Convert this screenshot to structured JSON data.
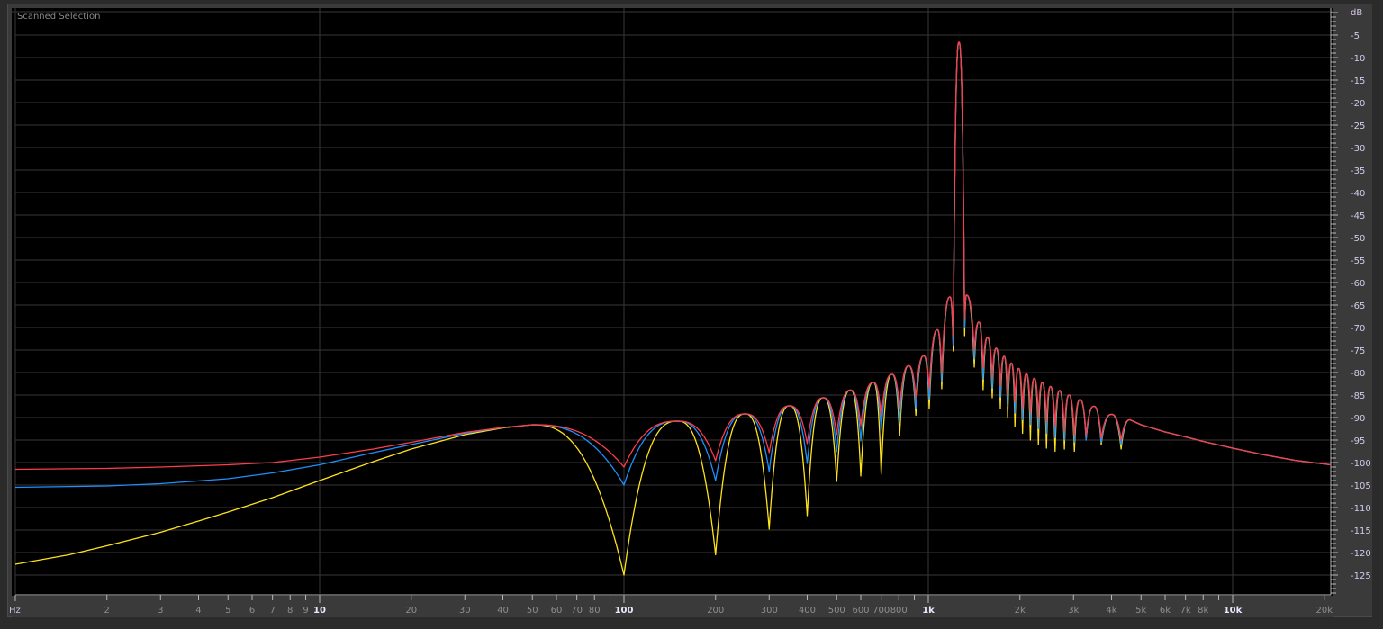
{
  "panel_title": "Scanned Selection",
  "chart_data": {
    "type": "line",
    "title": "",
    "xlabel": "Hz",
    "ylabel": "dB",
    "x_scale": "log",
    "xlim": [
      1,
      21000
    ],
    "ylim": [
      -129,
      0
    ],
    "grid": true,
    "background": "#000000",
    "grid_color": "#3b3638",
    "x_ticks": [
      {
        "hz": 2,
        "label": "2"
      },
      {
        "hz": 3,
        "label": "3"
      },
      {
        "hz": 4,
        "label": "4"
      },
      {
        "hz": 5,
        "label": "5"
      },
      {
        "hz": 6,
        "label": "6"
      },
      {
        "hz": 7,
        "label": "7"
      },
      {
        "hz": 8,
        "label": "8"
      },
      {
        "hz": 9,
        "label": "9"
      },
      {
        "hz": 10,
        "label": "10",
        "major": true
      },
      {
        "hz": 20,
        "label": "20"
      },
      {
        "hz": 30,
        "label": "30"
      },
      {
        "hz": 40,
        "label": "40"
      },
      {
        "hz": 50,
        "label": "50"
      },
      {
        "hz": 60,
        "label": "60"
      },
      {
        "hz": 70,
        "label": "70"
      },
      {
        "hz": 80,
        "label": "80"
      },
      {
        "hz": 90,
        "label": ""
      },
      {
        "hz": 100,
        "label": "100",
        "major": true
      },
      {
        "hz": 200,
        "label": "200"
      },
      {
        "hz": 300,
        "label": "300"
      },
      {
        "hz": 400,
        "label": "400"
      },
      {
        "hz": 500,
        "label": "500"
      },
      {
        "hz": 600,
        "label": "600"
      },
      {
        "hz": 700,
        "label": "700"
      },
      {
        "hz": 800,
        "label": "800"
      },
      {
        "hz": 900,
        "label": ""
      },
      {
        "hz": 1000,
        "label": "1k",
        "major": true
      },
      {
        "hz": 2000,
        "label": "2k"
      },
      {
        "hz": 3000,
        "label": "3k"
      },
      {
        "hz": 4000,
        "label": "4k"
      },
      {
        "hz": 5000,
        "label": "5k"
      },
      {
        "hz": 6000,
        "label": "6k"
      },
      {
        "hz": 7000,
        "label": "7k"
      },
      {
        "hz": 8000,
        "label": "8k"
      },
      {
        "hz": 9000,
        "label": ""
      },
      {
        "hz": 10000,
        "label": "10k",
        "major": true
      },
      {
        "hz": 20000,
        "label": "20k"
      }
    ],
    "y_ticks": [
      -5,
      -10,
      -15,
      -20,
      -25,
      -30,
      -35,
      -40,
      -45,
      -50,
      -55,
      -60,
      -65,
      -70,
      -75,
      -80,
      -85,
      -90,
      -95,
      -100,
      -105,
      -110,
      -115,
      -120,
      -125
    ],
    "y_tick_labels": [
      "-5",
      "-10",
      "-15",
      "-20",
      "-25",
      "-30",
      "-35",
      "-40",
      "-45",
      "-50",
      "-55",
      "-60",
      "-65",
      "-70",
      "-75",
      "-80",
      "-85",
      "-90",
      "-95",
      "-100",
      "-105",
      "-110",
      "-115",
      "-120",
      "-125"
    ],
    "lobe_peaks": [
      [
        150,
        -90.8
      ],
      [
        250,
        -89.2
      ],
      [
        350,
        -87.4
      ],
      [
        452,
        -85.6
      ],
      [
        555,
        -83.9
      ],
      [
        660,
        -82.2
      ],
      [
        760,
        -80.4
      ],
      [
        862,
        -78.5
      ],
      [
        966,
        -76.3
      ],
      [
        1071,
        -70.5
      ],
      [
        1178,
        -63.2
      ],
      [
        1261,
        -6.6
      ],
      [
        1335,
        -62.8
      ],
      [
        1466,
        -68.8
      ],
      [
        1565,
        -72.2
      ],
      [
        1672,
        -74.6
      ],
      [
        1775,
        -76.4
      ],
      [
        1875,
        -77.9
      ],
      [
        1980,
        -79.1
      ],
      [
        2100,
        -80.3
      ],
      [
        2230,
        -81.3
      ],
      [
        2370,
        -82.2
      ],
      [
        2520,
        -83.1
      ],
      [
        2700,
        -84
      ],
      [
        2900,
        -85
      ],
      [
        3150,
        -86
      ],
      [
        3500,
        -87.5
      ],
      [
        4000,
        -89.3
      ],
      [
        4600,
        -90.5
      ],
      [
        5000,
        -91.6
      ],
      [
        6000,
        -93.2
      ],
      [
        7000,
        -94.3
      ],
      [
        8000,
        -95.3
      ],
      [
        10000,
        -96.8
      ],
      [
        12500,
        -98.2
      ],
      [
        16000,
        -99.5
      ],
      [
        21000,
        -100.5
      ]
    ],
    "series": [
      {
        "color": "#ffe31a",
        "points": [
          [
            1,
            -122.6
          ],
          [
            1.5,
            -120.5
          ],
          [
            2,
            -118.5
          ],
          [
            3,
            -115.5
          ],
          [
            4,
            -113
          ],
          [
            5,
            -111
          ],
          [
            7,
            -107.8
          ],
          [
            10,
            -104
          ],
          [
            15,
            -99.8
          ],
          [
            20,
            -97
          ],
          [
            30,
            -93.8
          ],
          [
            40,
            -92.3
          ],
          [
            50,
            -91.6
          ],
          [
            100,
            -125
          ],
          [
            200,
            -120.5
          ],
          [
            300,
            -114.8
          ],
          [
            400,
            -111.8
          ],
          [
            500,
            -104.2
          ],
          [
            600,
            -103
          ],
          [
            700,
            -102.6
          ],
          [
            805,
            -94
          ],
          [
            910,
            -89.5
          ],
          [
            1007,
            -88
          ],
          [
            1107,
            -83.6
          ],
          [
            1208,
            -75.2
          ],
          [
            1316,
            -71.8
          ],
          [
            1416,
            -78.8
          ],
          [
            1514,
            -83.8
          ],
          [
            1622,
            -85.6
          ],
          [
            1725,
            -88
          ],
          [
            1823,
            -90
          ],
          [
            1926,
            -92
          ],
          [
            2040,
            -93.5
          ],
          [
            2165,
            -95
          ],
          [
            2300,
            -96
          ],
          [
            2445,
            -96.8
          ],
          [
            2610,
            -97.5
          ],
          [
            2800,
            -97
          ],
          [
            3020,
            -97.5
          ],
          [
            3300,
            -95
          ],
          [
            3700,
            -96
          ],
          [
            4300,
            -97
          ]
        ]
      },
      {
        "color": "#1e8fff",
        "points": [
          [
            1,
            -105.5
          ],
          [
            2,
            -105.2
          ],
          [
            3,
            -104.7
          ],
          [
            5,
            -103.6
          ],
          [
            7,
            -102.3
          ],
          [
            10,
            -100.5
          ],
          [
            15,
            -97.8
          ],
          [
            20,
            -96
          ],
          [
            30,
            -93.5
          ],
          [
            40,
            -92.2
          ],
          [
            50,
            -91.6
          ],
          [
            100,
            -105
          ],
          [
            200,
            -104
          ],
          [
            300,
            -102
          ],
          [
            400,
            -100.2
          ],
          [
            500,
            -97.6
          ],
          [
            600,
            -95.2
          ],
          [
            700,
            -93
          ],
          [
            805,
            -91
          ],
          [
            910,
            -88
          ],
          [
            1007,
            -86
          ],
          [
            1107,
            -82
          ],
          [
            1208,
            -74
          ],
          [
            1316,
            -70
          ],
          [
            1416,
            -77
          ],
          [
            1514,
            -81.5
          ],
          [
            1622,
            -83.5
          ],
          [
            1725,
            -85.5
          ],
          [
            1823,
            -87.5
          ],
          [
            1926,
            -89
          ],
          [
            2040,
            -90.5
          ],
          [
            2165,
            -91.5
          ],
          [
            2300,
            -92.5
          ],
          [
            2445,
            -93.5
          ],
          [
            2610,
            -94.5
          ],
          [
            2800,
            -95
          ],
          [
            3020,
            -95.5
          ],
          [
            3300,
            -95
          ],
          [
            3700,
            -95.5
          ],
          [
            4300,
            -96
          ]
        ]
      },
      {
        "color": "#ff3c4a",
        "points": [
          [
            1,
            -101.5
          ],
          [
            2,
            -101.3
          ],
          [
            3,
            -101
          ],
          [
            5,
            -100.5
          ],
          [
            7,
            -100
          ],
          [
            10,
            -98.8
          ],
          [
            15,
            -97
          ],
          [
            20,
            -95.5
          ],
          [
            30,
            -93.3
          ],
          [
            40,
            -92.2
          ],
          [
            50,
            -91.6
          ],
          [
            100,
            -101
          ],
          [
            200,
            -99.6
          ],
          [
            300,
            -97.8
          ],
          [
            400,
            -95.8
          ],
          [
            500,
            -93.8
          ],
          [
            600,
            -91.8
          ],
          [
            700,
            -89.8
          ],
          [
            805,
            -88
          ],
          [
            910,
            -85.5
          ],
          [
            1007,
            -83.5
          ],
          [
            1107,
            -80
          ],
          [
            1208,
            -72
          ],
          [
            1316,
            -68
          ],
          [
            1416,
            -75
          ],
          [
            1514,
            -79
          ],
          [
            1622,
            -81
          ],
          [
            1725,
            -83
          ],
          [
            1823,
            -85
          ],
          [
            1926,
            -86.5
          ],
          [
            2040,
            -88
          ],
          [
            2165,
            -89
          ],
          [
            2300,
            -90
          ],
          [
            2445,
            -91
          ],
          [
            2610,
            -92
          ],
          [
            2800,
            -93
          ],
          [
            3020,
            -94
          ],
          [
            3300,
            -94
          ],
          [
            3700,
            -94.5
          ],
          [
            4300,
            -95
          ]
        ]
      }
    ]
  }
}
